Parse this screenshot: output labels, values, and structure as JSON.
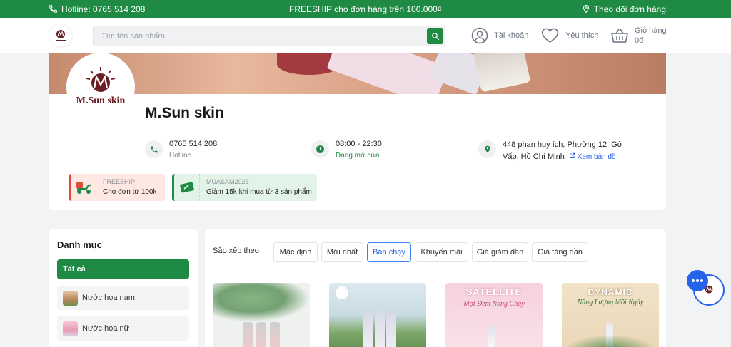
{
  "topbar": {
    "hotline": "Hotline: 0765 514 208",
    "freeship": "FREESHIP cho đơn hàng trên 100.000₫",
    "track": "Theo dõi đơn hàng"
  },
  "header": {
    "search_placeholder": "Tìm tên sản phẩm",
    "account": "Tài khoản",
    "favorites": "Yêu thích",
    "cart_label": "Giỏ hàng",
    "cart_total": "0đ"
  },
  "shop": {
    "name": "M.Sun skin",
    "logo_text": "M.Sun skin",
    "phone": "0765 514 208",
    "phone_caption": "Hotline",
    "hours": "08:00 - 22:30",
    "status": "Đang mở cửa",
    "address": "448 phan huy ích, Phường 12, Gò Vấp, Hồ Chí Minh",
    "map_link": "Xem bản đồ"
  },
  "vouchers": [
    {
      "code": "FREESHIP",
      "desc": "Cho đơn từ 100k"
    },
    {
      "code": "MUASAM2025",
      "desc": "Giảm 15k khi mua từ 3 sản phẩm"
    }
  ],
  "sidebar": {
    "title": "Danh mục",
    "items": [
      {
        "label": "Tất cả"
      },
      {
        "label": "Nước hoa nam"
      },
      {
        "label": "Nước hoa nữ"
      }
    ]
  },
  "sort": {
    "label": "Sắp xếp theo",
    "options": [
      "Mặc định",
      "Mới nhất",
      "Bán chạy",
      "Khuyến mãi",
      "Giá giảm dần",
      "Giá tăng dần"
    ],
    "active": "Bán chạy"
  },
  "products": [
    {
      "title": "",
      "subtitle": ""
    },
    {
      "title": "",
      "subtitle": ""
    },
    {
      "title": "SATELLITE",
      "subtitle": "Một Đêm Nồng Cháy"
    },
    {
      "title": "DYNAMIC",
      "subtitle": "Năng Lượng Mỗi Ngày"
    }
  ],
  "colors": {
    "brand_green": "#1f8a43",
    "accent_blue": "#2563eb",
    "logo_maroon": "#6b1f24"
  }
}
